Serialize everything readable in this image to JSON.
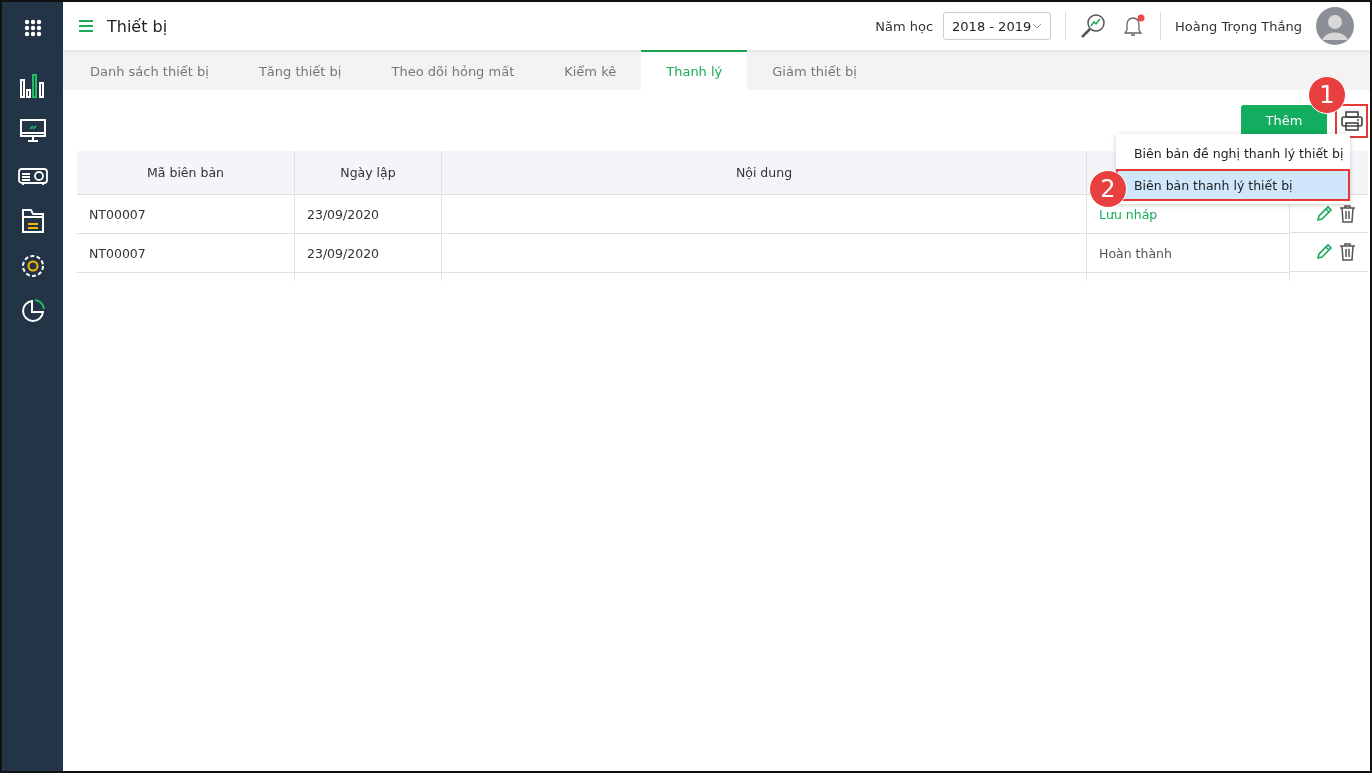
{
  "header": {
    "title": "Thiết bị",
    "school_year_label": "Năm học",
    "school_year": "2018 - 2019",
    "notification_unread": true,
    "user_name": "Hoàng Trọng  Thắng"
  },
  "sidebar": {
    "items": [
      {
        "kind": "chart",
        "selected": false
      },
      {
        "kind": "monitor",
        "selected": false
      },
      {
        "kind": "projector",
        "selected": false
      },
      {
        "kind": "folder",
        "selected": false
      },
      {
        "kind": "settings",
        "selected": false
      },
      {
        "kind": "pie",
        "selected": false
      }
    ]
  },
  "tabs": [
    {
      "label": "Danh sách thiết bị",
      "selected": false
    },
    {
      "label": "Tăng thiết bị",
      "selected": false
    },
    {
      "label": "Theo dõi hỏng mất",
      "selected": false
    },
    {
      "label": "Kiểm kê",
      "selected": false
    },
    {
      "label": "Thanh lý",
      "selected": true
    },
    {
      "label": "Giảm thiết bị",
      "selected": false
    }
  ],
  "toolbar": {
    "add_button": "Thêm",
    "print_highlighted": true,
    "print_callout": "1"
  },
  "print_menu": {
    "items": [
      {
        "label": "Biên bản đề nghị thanh lý thiết bị",
        "highlighted": false
      },
      {
        "label": "Biên bản thanh lý thiết bị",
        "highlighted": true,
        "callout": "2"
      }
    ]
  },
  "table": {
    "columns": [
      "Mã biên bản",
      "Ngày lập",
      "Nội dung"
    ],
    "rows": [
      {
        "code": "NT00007",
        "date": "23/09/2020",
        "status": "Lưu nháp",
        "color": "#1aaa5a"
      },
      {
        "code": "NT00007",
        "date": "23/09/2020",
        "status": "Hoàn thành",
        "color": "#555555"
      }
    ]
  }
}
